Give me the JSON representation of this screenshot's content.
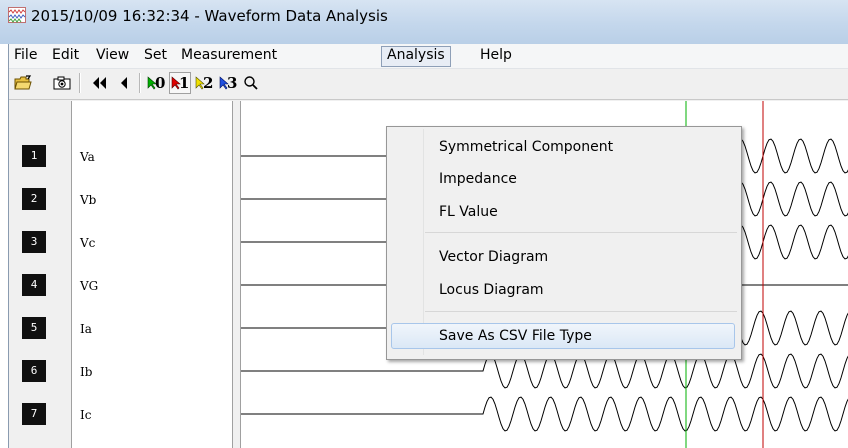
{
  "window": {
    "title": "2015/10/09 16:32:34  - Waveform Data Analysis"
  },
  "menubar": {
    "items": [
      "File",
      "Edit",
      "View",
      "Set",
      "Measurement",
      "Analysis",
      "Help"
    ],
    "active": "Analysis"
  },
  "toolbar": {
    "buttons": [
      "open-folder-icon",
      "camera-icon",
      "rewind-icon",
      "step-back-icon",
      "cursor-0-icon",
      "cursor-1-icon",
      "cursor-2-icon",
      "cursor-3-icon",
      "zoom-icon"
    ],
    "cursor_labels": [
      "0",
      "1",
      "2",
      "3"
    ],
    "active_cursor": "1"
  },
  "channels": [
    {
      "num": "1",
      "name": "Va"
    },
    {
      "num": "2",
      "name": "Vb"
    },
    {
      "num": "3",
      "name": "Vc"
    },
    {
      "num": "4",
      "name": "VG"
    },
    {
      "num": "5",
      "name": "Ia"
    },
    {
      "num": "6",
      "name": "Ib"
    },
    {
      "num": "7",
      "name": "Ic"
    }
  ],
  "analysis_menu": {
    "items": [
      "Symmetrical Component",
      "Impedance",
      "FL Value",
      "Vector Diagram",
      "Locus Diagram",
      "Save As CSV File Type"
    ],
    "highlighted": "Save As CSV File Type"
  },
  "colors": {
    "cursor_0": "#00b000",
    "cursor_1": "#c00000",
    "title_gradient_top": "#d7e4f2",
    "title_gradient_bottom": "#b9cfe7"
  }
}
